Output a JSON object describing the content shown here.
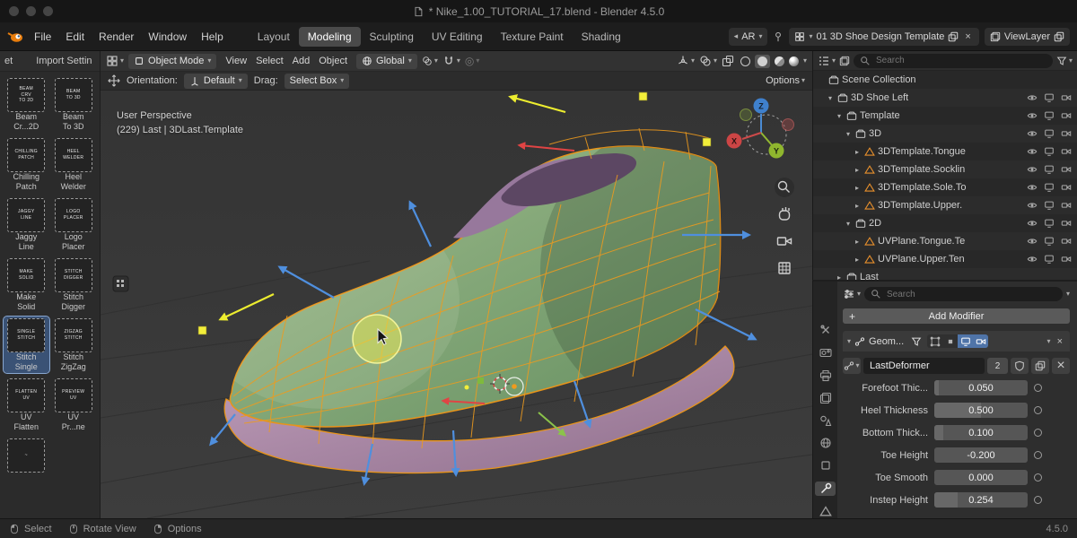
{
  "window": {
    "title": "* Nike_1.00_TUTORIAL_17.blend - Blender 4.5.0"
  },
  "menubar": {
    "menus": [
      "File",
      "Edit",
      "Render",
      "Window",
      "Help"
    ],
    "workspaces": [
      "Layout",
      "Modeling",
      "Sculpting",
      "UV Editing",
      "Texture Paint",
      "Shading"
    ],
    "active_workspace": "Modeling",
    "ar_label": "AR",
    "scene_name": "01 3D Shoe Design Template",
    "viewlayer_name": "ViewLayer"
  },
  "tool_header": {
    "mode": "Object Mode",
    "menus": [
      "View",
      "Select",
      "Add",
      "Object"
    ],
    "orientation": "Global"
  },
  "tool_settings": {
    "orientation_label": "Orientation:",
    "orientation_value": "Default",
    "drag_label": "Drag:",
    "drag_value": "Select Box",
    "options_label": "Options"
  },
  "left_panel": {
    "header_tab1": "et",
    "header_tab2": "Import Settin",
    "tools": [
      {
        "name": "beam-curve-2d",
        "icon_text": "BEAM\nCRV\nTO 2D",
        "line1": "Beam",
        "line2": "Cr...2D",
        "selected": false
      },
      {
        "name": "beam-to-3d",
        "icon_text": "BEAM\nTO 3D",
        "line1": "Beam",
        "line2": "To 3D",
        "selected": false
      },
      {
        "name": "chilling-patch",
        "icon_text": "CHILLING\nPATCH",
        "line1": "Chilling",
        "line2": "Patch",
        "selected": false
      },
      {
        "name": "heel-welder",
        "icon_text": "HEEL\nWELDER",
        "line1": "Heel",
        "line2": "Welder",
        "selected": false
      },
      {
        "name": "jaggy-line",
        "icon_text": "JAGGY\nLINE",
        "line1": "Jaggy",
        "line2": "Line",
        "selected": false
      },
      {
        "name": "logo-placer",
        "icon_text": "LOGO\nPLACER",
        "line1": "Logo",
        "line2": "Placer",
        "selected": false
      },
      {
        "name": "make-solid",
        "icon_text": "MAKE\nSOLID",
        "line1": "Make",
        "line2": "Solid",
        "selected": false
      },
      {
        "name": "stitch-digger",
        "icon_text": "STITCH\nDIGGER",
        "line1": "Stitch",
        "line2": "Digger",
        "selected": false
      },
      {
        "name": "stitch-single",
        "icon_text": "SINGLE\nSTITCH",
        "line1": "Stitch",
        "line2": "Single",
        "selected": true
      },
      {
        "name": "stitch-zigzag",
        "icon_text": "ZIGZAG\nSTITCH",
        "line1": "Stitch",
        "line2": "ZigZag",
        "selected": false
      },
      {
        "name": "uv-flatten",
        "icon_text": "FLATTEN\nUV",
        "line1": "UV",
        "line2": "Flatten",
        "selected": false
      },
      {
        "name": "uv-preview",
        "icon_text": "PREVIEW\nUV",
        "line1": "UV",
        "line2": "Pr...ne",
        "selected": false
      },
      {
        "name": "hidden-tool",
        "icon_text": "~",
        "line1": "",
        "line2": "",
        "selected": false
      }
    ]
  },
  "viewport": {
    "perspective": "User Perspective",
    "selection": "(229) Last | 3DLast.Template",
    "gizmo": {
      "x": "X",
      "y": "Y",
      "z": "Z"
    }
  },
  "outliner": {
    "search_placeholder": "Search",
    "rows": [
      {
        "label": "Scene Collection",
        "indent": 0,
        "icon": "scene-collection",
        "disclosure": "none",
        "vis": false
      },
      {
        "label": "3D Shoe Left",
        "indent": 1,
        "icon": "collection",
        "disclosure": "down",
        "vis": true
      },
      {
        "label": "Template",
        "indent": 2,
        "icon": "collection",
        "disclosure": "down",
        "vis": true
      },
      {
        "label": "3D",
        "indent": 3,
        "icon": "collection",
        "disclosure": "down",
        "vis": true
      },
      {
        "label": "3DTemplate.Tongue",
        "indent": 4,
        "icon": "data",
        "disclosure": "right",
        "vis": true
      },
      {
        "label": "3DTemplate.Socklin",
        "indent": 4,
        "icon": "data",
        "disclosure": "right",
        "vis": true
      },
      {
        "label": "3DTemplate.Sole.To",
        "indent": 4,
        "icon": "data",
        "disclosure": "right",
        "vis": true
      },
      {
        "label": "3DTemplate.Upper.",
        "indent": 4,
        "icon": "data",
        "disclosure": "right",
        "vis": true
      },
      {
        "label": "2D",
        "indent": 3,
        "icon": "collection",
        "disclosure": "down",
        "vis": true
      },
      {
        "label": "UVPlane.Tongue.Te",
        "indent": 4,
        "icon": "data",
        "disclosure": "right",
        "vis": true
      },
      {
        "label": "UVPlane.Upper.Ten",
        "indent": 4,
        "icon": "data",
        "disclosure": "right",
        "vis": true
      },
      {
        "label": "Last",
        "indent": 2,
        "icon": "collection",
        "disclosure": "right",
        "vis": false
      }
    ]
  },
  "properties": {
    "search_placeholder": "Search",
    "tabs": [
      "tool",
      "render",
      "output",
      "view-layer",
      "scene",
      "world",
      "object",
      "modifiers",
      "object-data"
    ],
    "active_tab": "modifiers",
    "add_modifier": "Add Modifier",
    "modifier": {
      "name": "Geom...",
      "node_group": "LastDeformer",
      "users": "2",
      "fields": [
        {
          "label": "Forefoot Thic...",
          "value": "0.050"
        },
        {
          "label": "Heel Thickness",
          "value": "0.500"
        },
        {
          "label": "Bottom Thick...",
          "value": "0.100"
        },
        {
          "label": "Toe Height",
          "value": "-0.200"
        },
        {
          "label": "Toe Smooth",
          "value": "0.000"
        },
        {
          "label": "Instep Height",
          "value": "0.254"
        }
      ]
    }
  },
  "statusbar": {
    "items": [
      {
        "label": "Select",
        "icon": "mouse-left"
      },
      {
        "label": "Rotate View",
        "icon": "mouse-middle"
      },
      {
        "label": "Options",
        "icon": "mouse-right"
      }
    ],
    "version": "4.5.0"
  }
}
